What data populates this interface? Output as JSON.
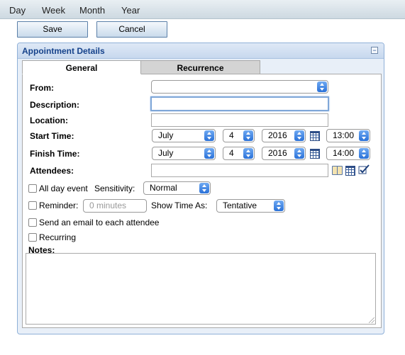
{
  "view_tabs": [
    "Day",
    "Week",
    "Month",
    "Year"
  ],
  "toolbar": {
    "save_label": "Save",
    "cancel_label": "Cancel"
  },
  "panel": {
    "title": "Appointment Details",
    "collapse_symbol": "−"
  },
  "tabs": [
    {
      "label": "General",
      "active": true
    },
    {
      "label": "Recurrence",
      "active": false
    }
  ],
  "form": {
    "from_label": "From:",
    "from_value": "",
    "description_label": "Description:",
    "description_value": "",
    "location_label": "Location:",
    "location_value": "",
    "start_label": "Start Time:",
    "start": {
      "month": "July",
      "day": "4",
      "year": "2016",
      "time": "13:00"
    },
    "finish_label": "Finish Time:",
    "finish": {
      "month": "July",
      "day": "4",
      "year": "2016",
      "time": "14:00"
    },
    "attendees_label": "Attendees:",
    "attendees_value": "",
    "all_day_label": "All day event",
    "sensitivity_label": "Sensitivity:",
    "sensitivity_value": "Normal",
    "reminder_label": "Reminder:",
    "reminder_value": "0 minutes",
    "show_time_as_label": "Show Time As:",
    "show_time_as_value": "Tentative",
    "email_label": "Send an email to each attendee",
    "recurring_label": "Recurring",
    "notes_label": "Notes:",
    "notes_value": ""
  },
  "icons": {
    "calendar": "calendar-icon",
    "address_book": "address-book-icon",
    "check": "check-icon"
  },
  "colors": {
    "panel_title": "#15428b",
    "select_arrow": "#2a71d8"
  }
}
